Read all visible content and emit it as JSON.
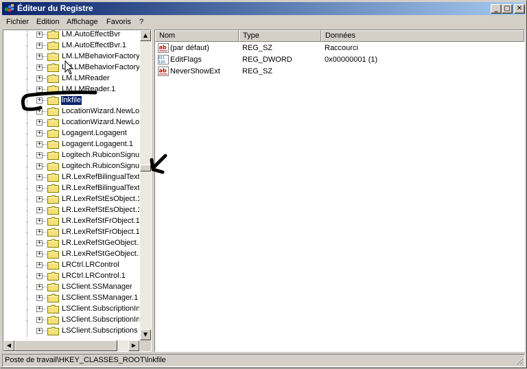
{
  "window": {
    "title": "Éditeur du Registre",
    "controls": {
      "minimize": "_",
      "maximize": "□",
      "close": "✕"
    }
  },
  "menu": [
    "Fichier",
    "Edition",
    "Affichage",
    "Favoris",
    "?"
  ],
  "tree": {
    "items": [
      {
        "label": "LM.AutoEffectBvr",
        "selected": false
      },
      {
        "label": "LM.AutoEffectBvr.1",
        "selected": false
      },
      {
        "label": "LM.LMBehaviorFactory",
        "selected": false
      },
      {
        "label": "LM.LMBehaviorFactory.1",
        "selected": false
      },
      {
        "label": "LM.LMReader",
        "selected": false
      },
      {
        "label": "LM.LMReader.1",
        "selected": false
      },
      {
        "label": "lnkfile",
        "selected": true
      },
      {
        "label": "LocationWizard.NewLoca",
        "selected": false
      },
      {
        "label": "LocationWizard.NewLoca",
        "selected": false
      },
      {
        "label": "Logagent.Logagent",
        "selected": false
      },
      {
        "label": "Logagent.Logagent.1",
        "selected": false
      },
      {
        "label": "Logitech.RubiconSignup",
        "selected": false
      },
      {
        "label": "Logitech.RubiconSignup",
        "selected": false
      },
      {
        "label": "LR.LexRefBilingualTextC",
        "selected": false
      },
      {
        "label": "LR.LexRefBilingualTextC",
        "selected": false
      },
      {
        "label": "LR.LexRefStEsObject.1.",
        "selected": false
      },
      {
        "label": "LR.LexRefStEsObject.1.",
        "selected": false
      },
      {
        "label": "LR.LexRefStFrObject.1.",
        "selected": false
      },
      {
        "label": "LR.LexRefStFrObject.1.",
        "selected": false
      },
      {
        "label": "LR.LexRefStGeObject.1",
        "selected": false
      },
      {
        "label": "LR.LexRefStGeObject.1",
        "selected": false
      },
      {
        "label": "LRCtrl.LRControl",
        "selected": false
      },
      {
        "label": "LRCtrl.LRControl.1",
        "selected": false
      },
      {
        "label": "LSClient.SSManager",
        "selected": false
      },
      {
        "label": "LSClient.SSManager.1",
        "selected": false
      },
      {
        "label": "LSClient.SubscriptionInfo",
        "selected": false
      },
      {
        "label": "LSClient.SubscriptionInfo",
        "selected": false
      },
      {
        "label": "LSClient.Subscriptions",
        "selected": false
      }
    ],
    "expander_symbol": "+"
  },
  "values": {
    "columns": [
      "Nom",
      "Type",
      "Données"
    ],
    "rows": [
      {
        "icon": "string-value-icon",
        "name": "(par défaut)",
        "type": "REG_SZ",
        "data": "Raccourci"
      },
      {
        "icon": "binary-value-icon",
        "name": "EditFlags",
        "type": "REG_DWORD",
        "data": "0x00000001 (1)"
      },
      {
        "icon": "string-value-icon",
        "name": "NeverShowExt",
        "type": "REG_SZ",
        "data": ""
      }
    ]
  },
  "status": {
    "path": "Poste de travail\\HKEY_CLASSES_ROOT\\lnkfile"
  },
  "colors": {
    "selection": "#0a246a",
    "title_start": "#0a246a",
    "title_end": "#a6caf0",
    "folder": "#f4e07a",
    "annotation": "#000000"
  }
}
